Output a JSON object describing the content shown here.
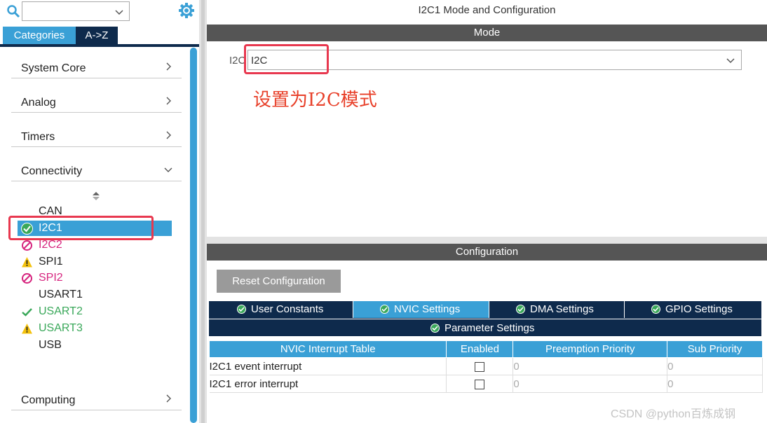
{
  "left": {
    "tabs": {
      "categories": "Categories",
      "az": "A->Z"
    },
    "groups": {
      "system_core": "System Core",
      "analog": "Analog",
      "timers": "Timers",
      "connectivity": "Connectivity",
      "computing": "Computing"
    },
    "peripherals": [
      {
        "name": "CAN",
        "status": "none",
        "color": "#333333"
      },
      {
        "name": "I2C1",
        "status": "ok",
        "color": "#ffffff"
      },
      {
        "name": "I2C2",
        "status": "blocked",
        "color": "#d6247e"
      },
      {
        "name": "SPI1",
        "status": "warning",
        "color": "#333333"
      },
      {
        "name": "SPI2",
        "status": "blocked",
        "color": "#d6247e"
      },
      {
        "name": "USART1",
        "status": "none",
        "color": "#333333"
      },
      {
        "name": "USART2",
        "status": "checked",
        "color": "#3aa85a"
      },
      {
        "name": "USART3",
        "status": "warning",
        "color": "#3aa85a"
      },
      {
        "name": "USB",
        "status": "none",
        "color": "#333333"
      }
    ]
  },
  "right": {
    "title": "I2C1 Mode and Configuration",
    "mode_bar": "Mode",
    "mode_label": "I2C",
    "mode_value": "I2C",
    "annotation": "设置为I2C模式",
    "config_bar": "Configuration",
    "reset_button": "Reset Configuration",
    "config_tabs": [
      "User Constants",
      "NVIC Settings",
      "DMA Settings",
      "GPIO Settings"
    ],
    "param_tab": "Parameter Settings",
    "table": {
      "headers": [
        "NVIC Interrupt Table",
        "Enabled",
        "Preemption Priority",
        "Sub Priority"
      ],
      "rows": [
        {
          "name": "I2C1 event interrupt",
          "enabled": false,
          "preemption": "0",
          "sub": "0"
        },
        {
          "name": "I2C1 error interrupt",
          "enabled": false,
          "preemption": "0",
          "sub": "0"
        }
      ]
    }
  },
  "watermark": "CSDN @python百炼成钢",
  "colors": {
    "accent": "#3aa0d6",
    "navy": "#0e2a4c",
    "bar": "#555555",
    "annotation": "#e8402a",
    "highlight": "#e8384f"
  }
}
